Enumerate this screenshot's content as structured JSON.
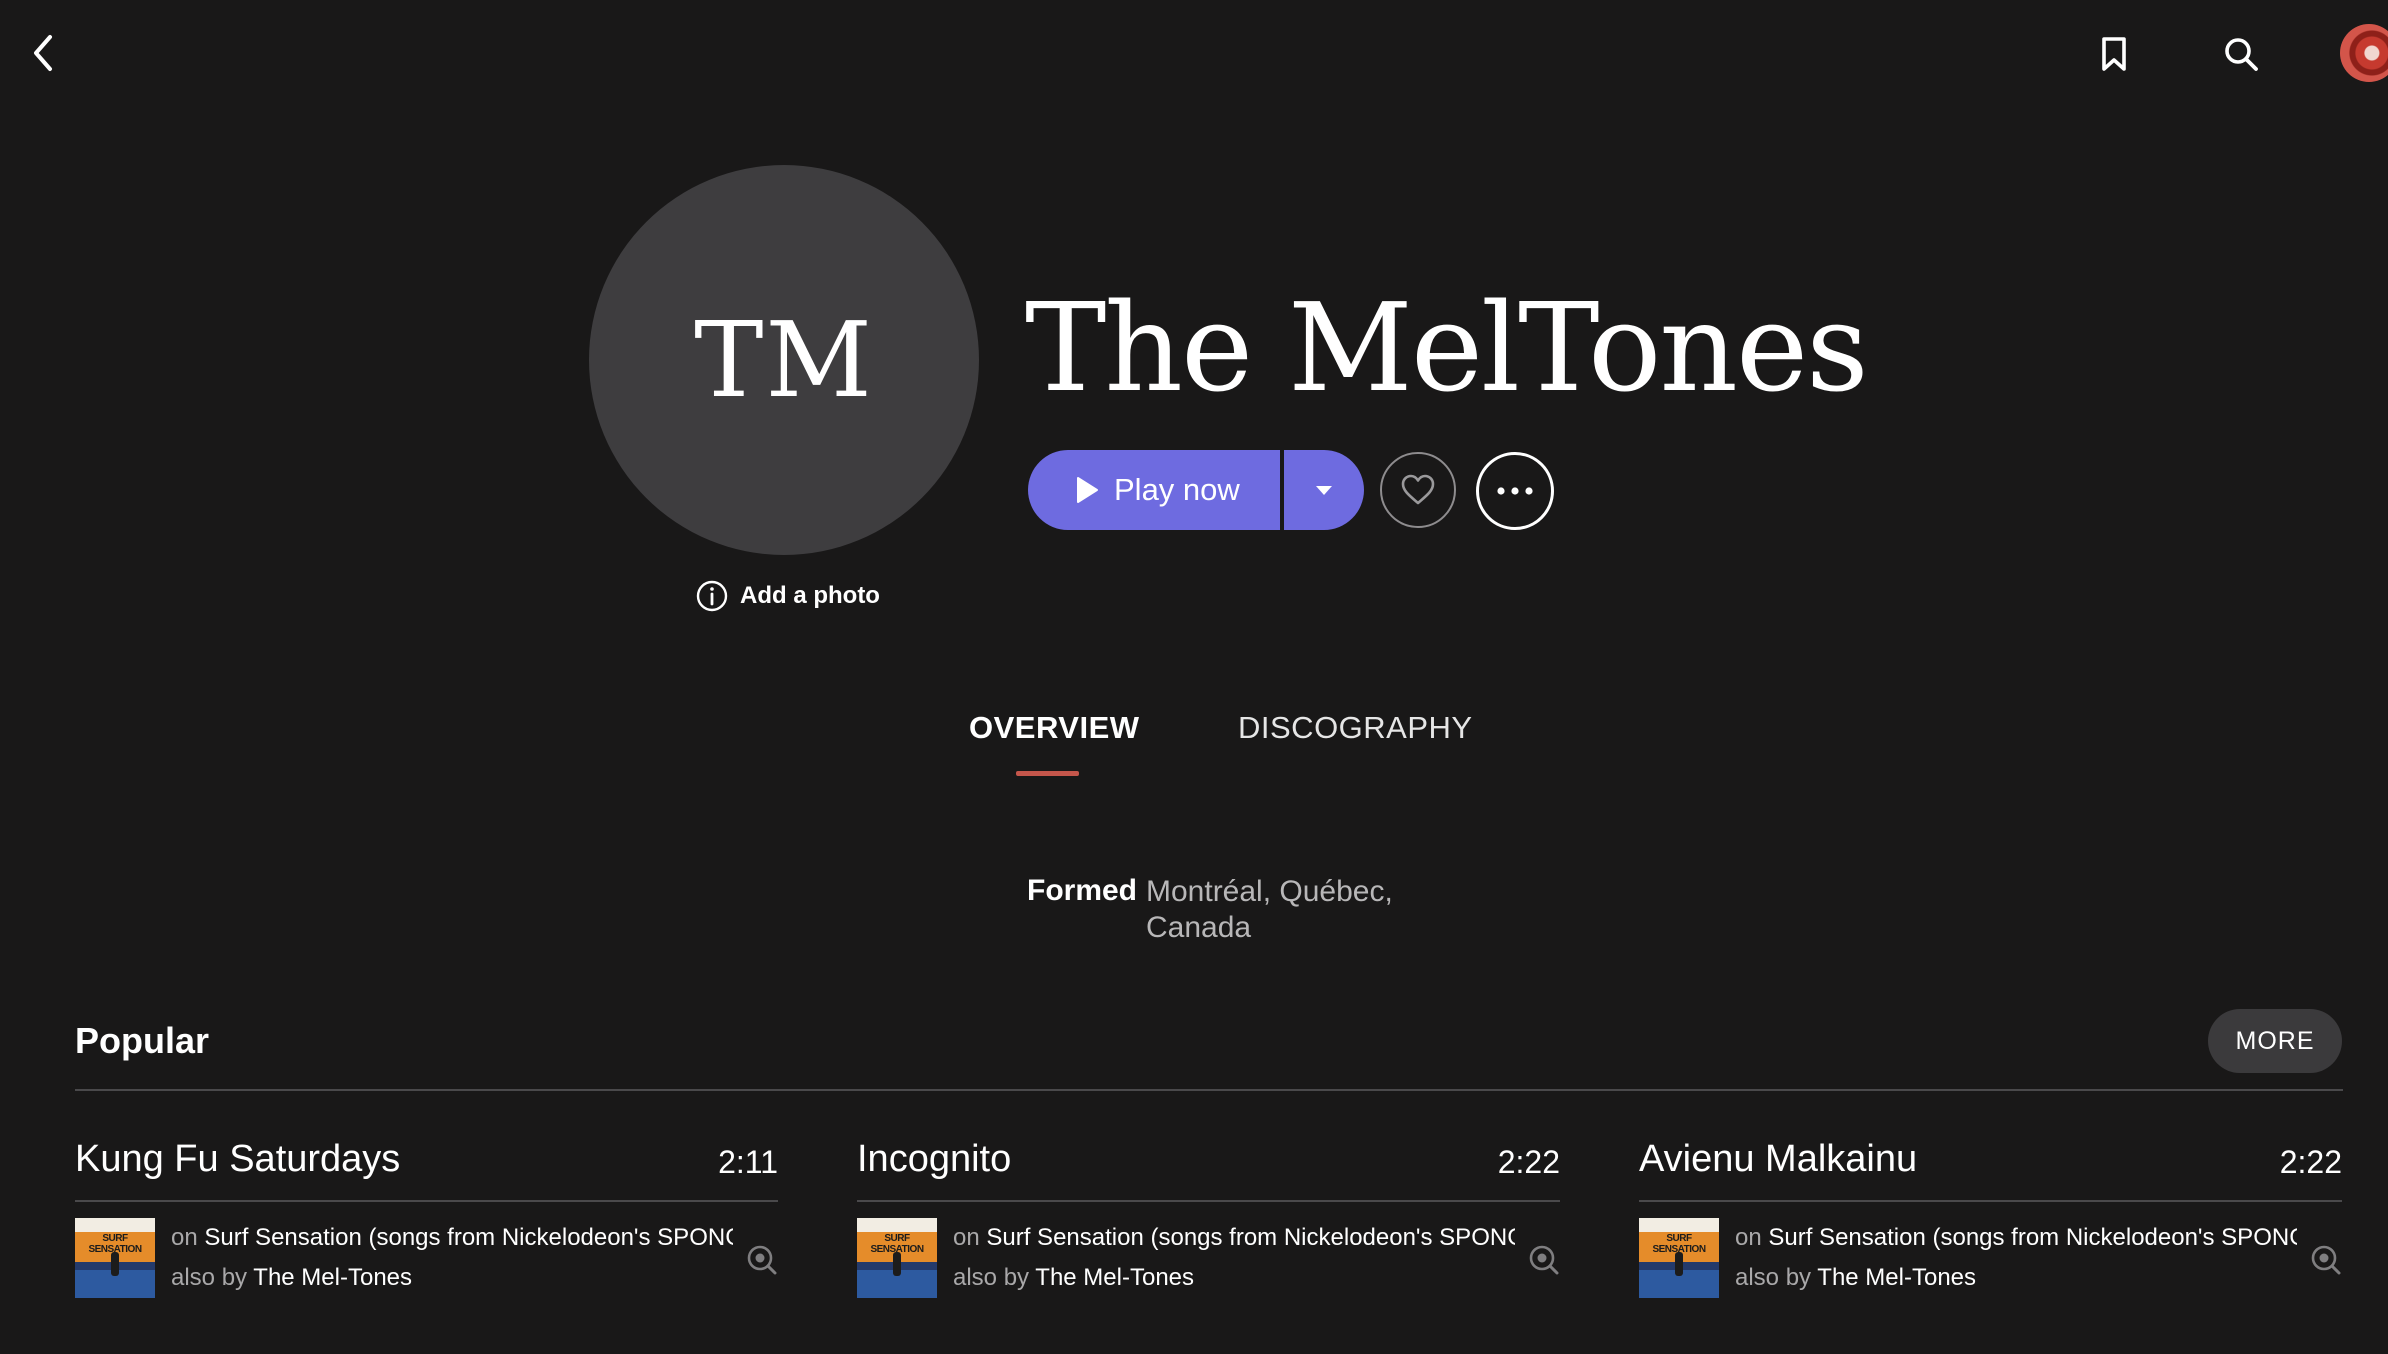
{
  "artist": {
    "initials": "TM",
    "name": "The MelTones",
    "add_photo_label": "Add a photo"
  },
  "actions": {
    "play_label": "Play now"
  },
  "tabs": [
    {
      "label": "OVERVIEW",
      "active": true
    },
    {
      "label": "DISCOGRAPHY",
      "active": false
    }
  ],
  "formed": {
    "label": "Formed",
    "value": "Montréal, Québec, Canada"
  },
  "popular": {
    "title": "Popular",
    "more_label": "MORE",
    "tracks": [
      {
        "title": "Kung Fu Saturdays",
        "duration": "2:11",
        "on_prefix": "on",
        "album": "Surf Sensation (songs from Nickelodeon's SPONGEBOB SQUAREPANTS)",
        "also_prefix": "also by",
        "also_artist": "The Mel-Tones",
        "cover_text": "SURF SENSATION"
      },
      {
        "title": "Incognito",
        "duration": "2:22",
        "on_prefix": "on",
        "album": "Surf Sensation (songs from Nickelodeon's SPONGEBOB SQUAREPANTS)",
        "also_prefix": "also by",
        "also_artist": "The Mel-Tones",
        "cover_text": "SURF SENSATION"
      },
      {
        "title": "Avienu Malkainu",
        "duration": "2:22",
        "on_prefix": "on",
        "album": "Surf Sensation (songs from Nickelodeon's SPONGEBOB SQUAREPANTS)",
        "also_prefix": "also by",
        "also_artist": "The Mel-Tones",
        "cover_text": "SURF SENSATION"
      }
    ]
  },
  "colors": {
    "background": "#191818",
    "accent": "#6e6be0",
    "tab_underline": "#c5564b",
    "circle": "#3e3d3f"
  },
  "icons": [
    "back-icon",
    "bookmark-icon",
    "search-icon",
    "avatar",
    "info-icon",
    "play-icon",
    "chevron-down-icon",
    "heart-icon",
    "ellipsis-icon",
    "record-search-icon"
  ]
}
